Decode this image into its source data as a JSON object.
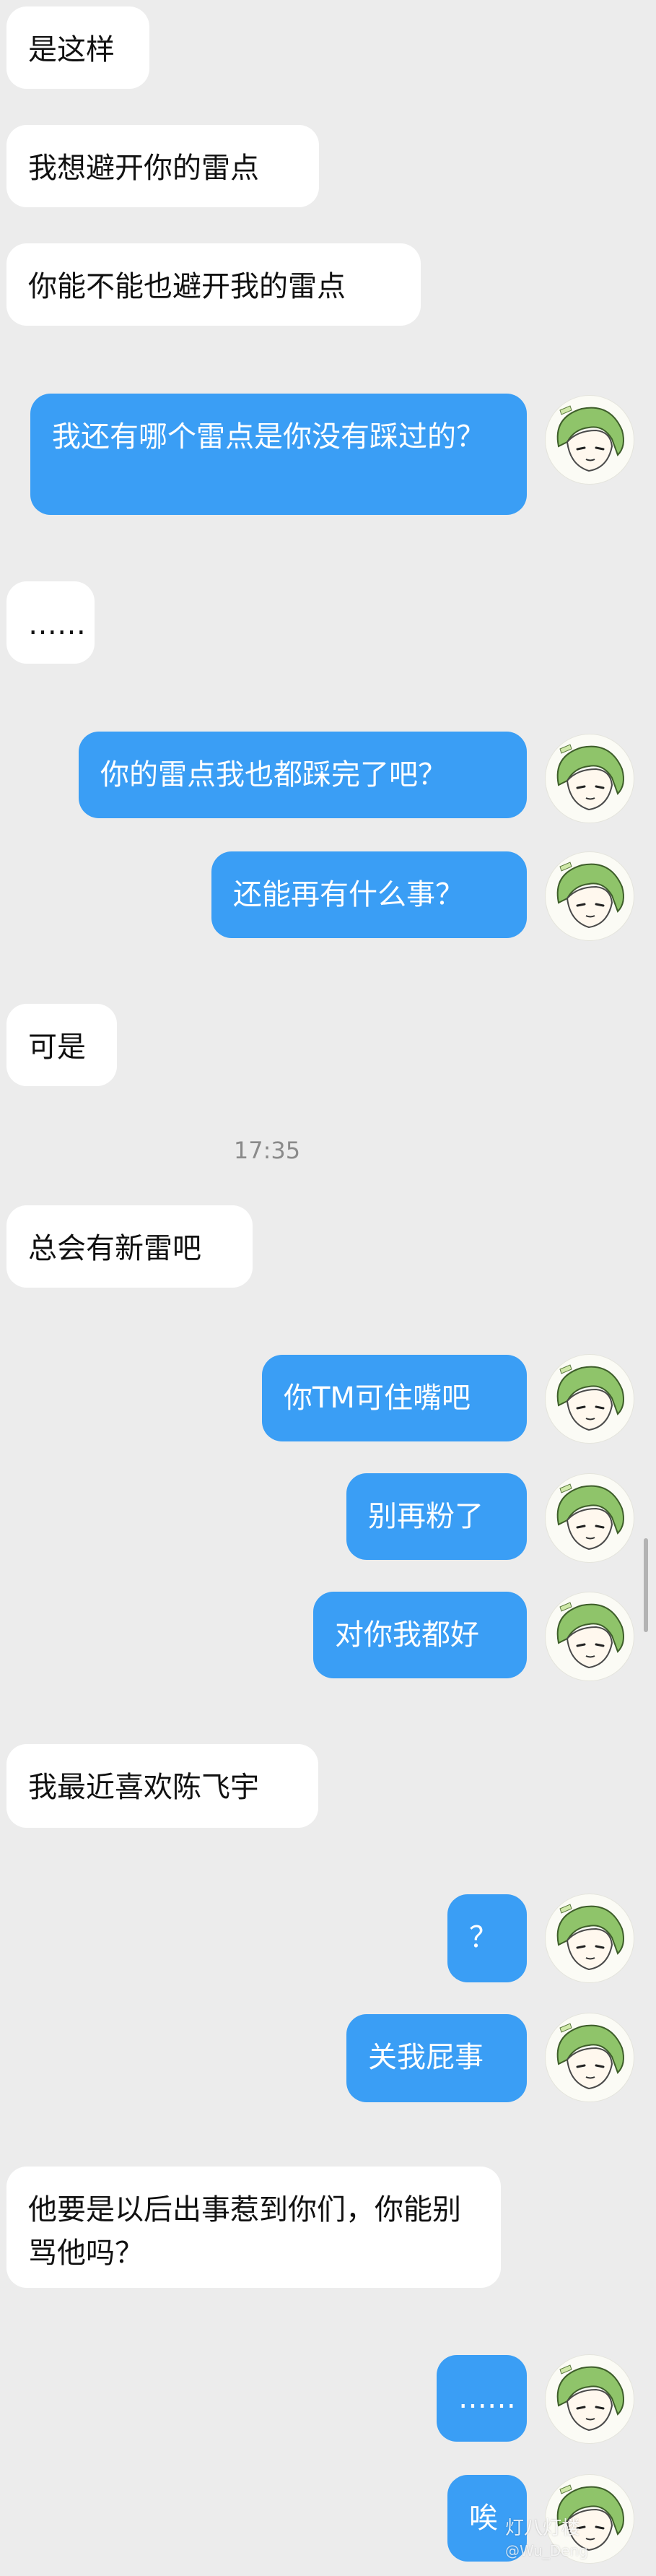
{
  "messages": [
    {
      "side": "left",
      "text": "是这样"
    },
    {
      "side": "left",
      "text": "我想避开你的雷点"
    },
    {
      "side": "left",
      "text": "你能不能也避开我的雷点"
    },
    {
      "side": "right",
      "text": "我还有哪个雷点是你没有踩过的？"
    },
    {
      "side": "left",
      "text": "……"
    },
    {
      "side": "right",
      "text": "你的雷点我也都踩完了吧？"
    },
    {
      "side": "right",
      "text": "还能再有什么事？"
    },
    {
      "side": "left",
      "text": "可是"
    },
    {
      "side": "time",
      "text": "17:35"
    },
    {
      "side": "left",
      "text": "总会有新雷吧"
    },
    {
      "side": "right",
      "text": "你TM可住嘴吧"
    },
    {
      "side": "right",
      "text": "别再粉了"
    },
    {
      "side": "right",
      "text": "对你我都好"
    },
    {
      "side": "left",
      "text": "我最近喜欢陈飞宇"
    },
    {
      "side": "right",
      "text": "？"
    },
    {
      "side": "right",
      "text": "关我屁事"
    },
    {
      "side": "left",
      "text": "他要是以后出事惹到你们，你能别骂他吗？"
    },
    {
      "side": "right",
      "text": "……"
    },
    {
      "side": "right",
      "text": "唉"
    }
  ],
  "avatar": {
    "icon": "green-hair-character-avatar-icon"
  },
  "watermark": {
    "line1": "灯八灯楼",
    "line2": "@Wu_Deng"
  },
  "colors": {
    "outgoing_bubble": "#3a9ef5",
    "incoming_bubble": "#ffffff",
    "background": "#ececec"
  }
}
